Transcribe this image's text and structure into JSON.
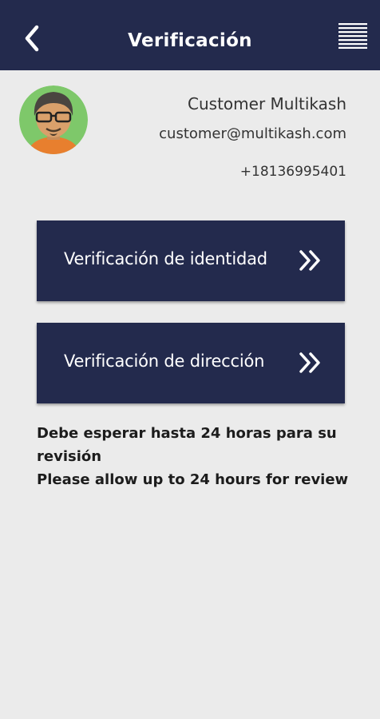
{
  "header": {
    "title": "Verificación",
    "back_icon": "chevron-left-icon",
    "menu_icon": "menu-lines-icon"
  },
  "profile": {
    "avatar_icon": "user-avatar-icon",
    "name": "Customer Multikash",
    "email": "customer@multikash.com",
    "phone": "+18136995401"
  },
  "actions": {
    "identity_label": "Verificación de identidad",
    "address_label": "Verificación de dirección",
    "arrow_icon": "double-chevron-right-icon"
  },
  "notice": {
    "line_es": "Debe esperar hasta 24 horas para su revisión",
    "line_en": "Please allow up to 24 hours for review"
  },
  "colors": {
    "header_bg": "#232a4d",
    "button_bg": "#232a4d",
    "page_bg": "#ebebeb"
  }
}
